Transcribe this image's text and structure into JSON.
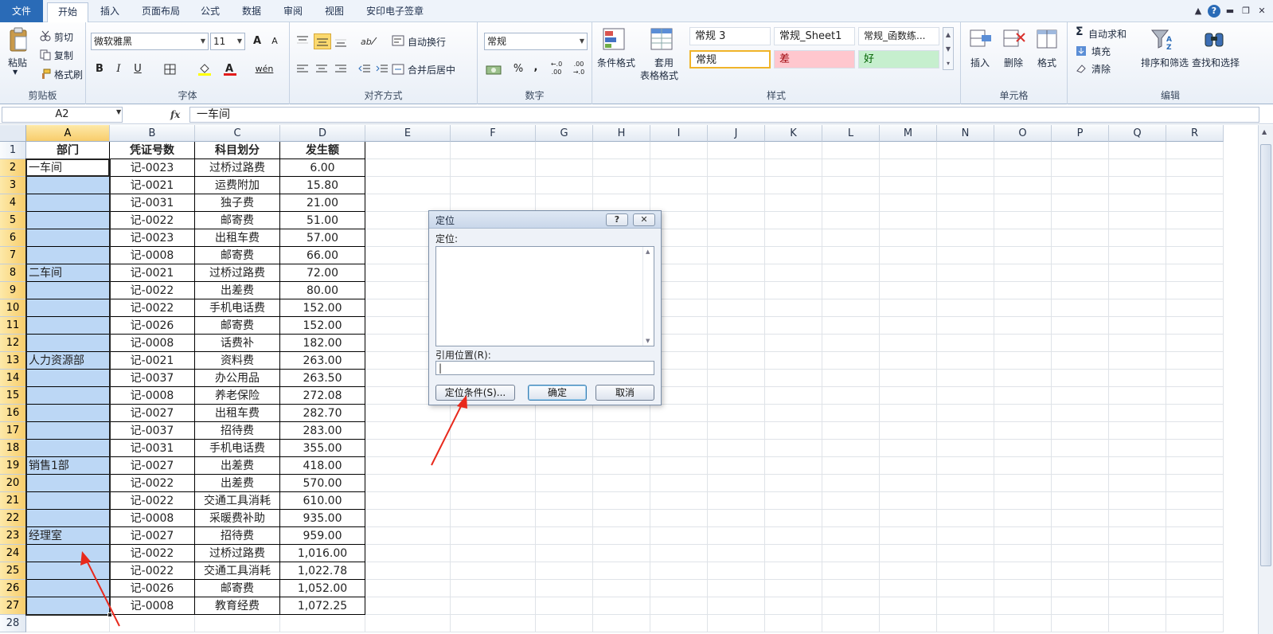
{
  "menu": {
    "file": "文件",
    "tabs": [
      "开始",
      "插入",
      "页面布局",
      "公式",
      "数据",
      "审阅",
      "视图",
      "安印电子签章"
    ]
  },
  "ribbon": {
    "clipboard": {
      "paste": "粘贴",
      "cut": "剪切",
      "copy": "复制",
      "format_painter": "格式刷",
      "label": "剪贴板"
    },
    "font": {
      "name": "微软雅黑",
      "size": "11",
      "label": "字体",
      "bold": "B",
      "italic": "I",
      "underline": "U",
      "wen": "wén",
      "grow": "A",
      "shrink": "A"
    },
    "alignment": {
      "wrap": "自动换行",
      "merge": "合并后居中",
      "label": "对齐方式"
    },
    "number": {
      "format": "常规",
      "percent": "%",
      "comma": ",",
      "inc_decimal": "←.0 .00",
      "dec_decimal": ".00 →.0",
      "label": "数字"
    },
    "styles": {
      "cond_format": "条件格式",
      "table_format_1": "套用",
      "table_format_2": "表格格式",
      "label": "样式",
      "cells": [
        "常规 3",
        "常规_Sheet1",
        "常规_函数练...",
        "常规",
        "差",
        "好"
      ]
    },
    "cells": {
      "insert": "插入",
      "delete": "删除",
      "format": "格式",
      "label": "单元格"
    },
    "editing": {
      "autosum": "自动求和",
      "fill": "填充",
      "clear": "清除",
      "sort": "排序和筛选",
      "find": "查找和选择",
      "label": "编辑",
      "sigma": "Σ"
    }
  },
  "formula_bar": {
    "name_box": "A2",
    "fx": "fx",
    "content": "一车间"
  },
  "grid": {
    "columns": [
      "A",
      "B",
      "C",
      "D",
      "E",
      "F",
      "G",
      "H",
      "I",
      "J",
      "K",
      "L",
      "M",
      "N",
      "O",
      "P",
      "Q",
      "R"
    ],
    "rows": [
      "1",
      "2",
      "3",
      "4",
      "5",
      "6",
      "7",
      "8",
      "9",
      "10",
      "11",
      "12",
      "13",
      "14",
      "15",
      "16",
      "17",
      "18",
      "19",
      "20",
      "21",
      "22",
      "23",
      "24",
      "25",
      "26",
      "27",
      "28"
    ],
    "header": [
      "部门",
      "凭证号数",
      "科目划分",
      "发生额"
    ],
    "departments": {
      "2": "一车间",
      "8": "二车间",
      "13": "人力资源部",
      "19": "销售1部",
      "23": "经理室"
    },
    "data": [
      [
        "记-0023",
        "过桥过路费",
        "6.00"
      ],
      [
        "记-0021",
        "运费附加",
        "15.80"
      ],
      [
        "记-0031",
        "独子费",
        "21.00"
      ],
      [
        "记-0022",
        "邮寄费",
        "51.00"
      ],
      [
        "记-0023",
        "出租车费",
        "57.00"
      ],
      [
        "记-0008",
        "邮寄费",
        "66.00"
      ],
      [
        "记-0021",
        "过桥过路费",
        "72.00"
      ],
      [
        "记-0022",
        "出差费",
        "80.00"
      ],
      [
        "记-0022",
        "手机电话费",
        "152.00"
      ],
      [
        "记-0026",
        "邮寄费",
        "152.00"
      ],
      [
        "记-0008",
        "话费补",
        "182.00"
      ],
      [
        "记-0021",
        "资料费",
        "263.00"
      ],
      [
        "记-0037",
        "办公用品",
        "263.50"
      ],
      [
        "记-0008",
        "养老保险",
        "272.08"
      ],
      [
        "记-0027",
        "出租车费",
        "282.70"
      ],
      [
        "记-0037",
        "招待费",
        "283.00"
      ],
      [
        "记-0031",
        "手机电话费",
        "355.00"
      ],
      [
        "记-0027",
        "出差费",
        "418.00"
      ],
      [
        "记-0022",
        "出差费",
        "570.00"
      ],
      [
        "记-0022",
        "交通工具消耗",
        "610.00"
      ],
      [
        "记-0008",
        "采暖费补助",
        "935.00"
      ],
      [
        "记-0027",
        "招待费",
        "959.00"
      ],
      [
        "记-0022",
        "过桥过路费",
        "1,016.00"
      ],
      [
        "记-0022",
        "交通工具消耗",
        "1,022.78"
      ],
      [
        "记-0026",
        "邮寄费",
        "1,052.00"
      ],
      [
        "记-0008",
        "教育经费",
        "1,072.25"
      ]
    ]
  },
  "dialog": {
    "title": "定位",
    "help": "?",
    "close": "✕",
    "goto_label": "定位:",
    "ref_label": "引用位置(R):",
    "ref_value": "|",
    "special_button": "定位条件(S)...",
    "ok_button": "确定",
    "cancel_button": "取消"
  },
  "colors": {
    "accent": "#2a6bb7",
    "selection": "#bcd7f5",
    "annotation_arrow": "#e8291c",
    "bad_bg": "#ffc7ce",
    "bad_fg": "#9c0006",
    "good_bg": "#c6efce",
    "good_fg": "#006100"
  }
}
